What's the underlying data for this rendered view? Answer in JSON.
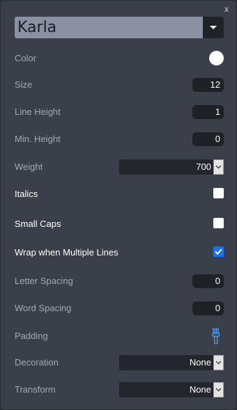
{
  "window": {
    "close_label": "x"
  },
  "font": {
    "selected": "Karla"
  },
  "rows": {
    "color": {
      "label": "Color",
      "value": "#ffffff"
    },
    "size": {
      "label": "Size",
      "value": "12"
    },
    "line_height": {
      "label": "Line Height",
      "value": "1"
    },
    "min_height": {
      "label": "Min. Height",
      "value": "0"
    },
    "weight": {
      "label": "Weight",
      "value": "700"
    },
    "italics": {
      "label": "Italics",
      "checked": false
    },
    "small_caps": {
      "label": "Small Caps",
      "checked": false
    },
    "wrap": {
      "label": "Wrap when Multiple Lines",
      "checked": true
    },
    "letter_spacing": {
      "label": "Letter Spacing",
      "value": "0"
    },
    "word_spacing": {
      "label": "Word Spacing",
      "value": "0"
    },
    "padding": {
      "label": "Padding",
      "icon": "brush-icon"
    },
    "decoration": {
      "label": "Decoration",
      "value": "None"
    },
    "transform": {
      "label": "Transform",
      "value": "None"
    }
  },
  "colors": {
    "panel_bg": "#3a3f4a",
    "input_bg": "#1e2126",
    "label_dim": "#a3a8b2",
    "accent": "#1a73e8",
    "font_select_bg": "#8a91a3"
  }
}
